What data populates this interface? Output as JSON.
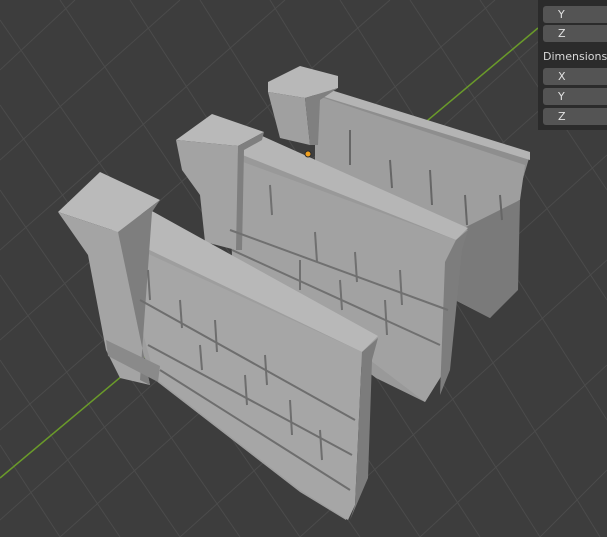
{
  "properties_panel": {
    "location_rows": [
      {
        "axis": "Y"
      },
      {
        "axis": "Z"
      }
    ],
    "dimensions_label": "Dimensions",
    "dimension_rows": [
      {
        "axis": "X"
      },
      {
        "axis": "Y"
      },
      {
        "axis": "Z"
      }
    ]
  },
  "viewport": {
    "background_color": "#3d3d3d",
    "grid_color": "#4a4a4a",
    "y_axis_color": "#6a9a2a",
    "origin_color": "#f0a020",
    "object_light": "#9c9c9c",
    "object_dark": "#6e6e6e",
    "object_count": 3
  }
}
